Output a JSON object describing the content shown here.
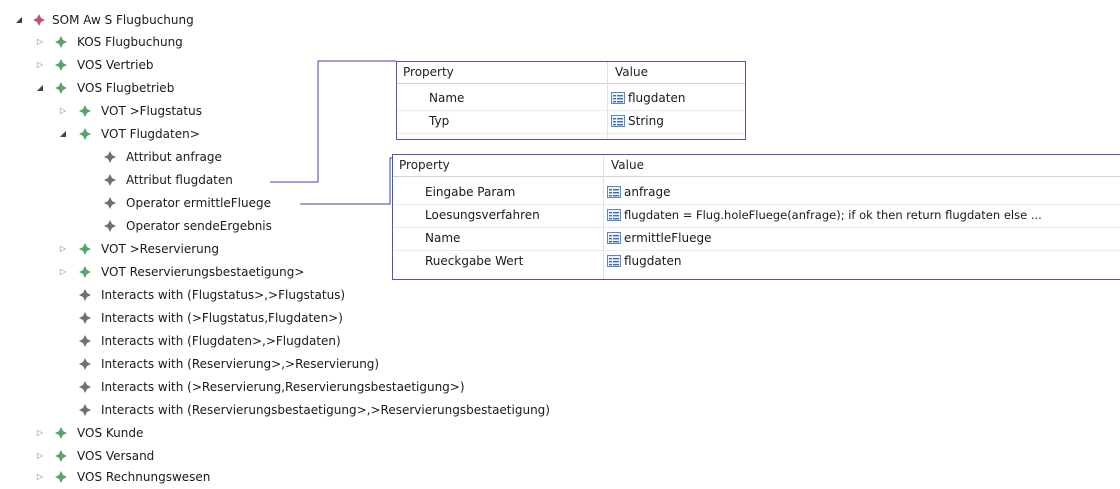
{
  "tree": {
    "root": "SOM Aw S Flugbuchung",
    "kos_flugbuchung": "KOS Flugbuchung",
    "vos_vertrieb": "VOS Vertrieb",
    "vos_flugbetrieb": "VOS Flugbetrieb",
    "vot_flugstatus": "VOT >Flugstatus",
    "vot_flugdaten": "VOT Flugdaten>",
    "attr_anfrage": "Attribut anfrage",
    "attr_flugdaten": "Attribut flugdaten",
    "op_ermittle": "Operator ermittleFluege",
    "op_sende": "Operator sendeErgebnis",
    "vot_reservierung": "VOT >Reservierung",
    "vot_resbest": "VOT Reservierungsbestaetigung>",
    "inter_1": "Interacts with (Flugstatus>,>Flugstatus)",
    "inter_2": "Interacts with (>Flugstatus,Flugdaten>)",
    "inter_3": "Interacts with (Flugdaten>,>Flugdaten)",
    "inter_4": "Interacts with (Reservierung>,>Reservierung)",
    "inter_5": "Interacts with (>Reservierung,Reservierungsbestaetigung>)",
    "inter_6": "Interacts with (Reservierungsbestaetigung>,>Reservierungsbestaetigung)",
    "vos_kunde": "VOS Kunde",
    "vos_versand": "VOS Versand",
    "vos_rechnung": "VOS Rechnungswesen"
  },
  "props_attr": {
    "header_property": "Property",
    "header_value": "Value",
    "rows": [
      {
        "name": "Name",
        "value": "flugdaten"
      },
      {
        "name": "Typ",
        "value": "String"
      }
    ]
  },
  "props_op": {
    "header_property": "Property",
    "header_value": "Value",
    "rows": [
      {
        "name": "Eingabe Param",
        "value": "anfrage"
      },
      {
        "name": "Loesungsverfahren",
        "value": "flugdaten = Flug.holeFluege(anfrage); if ok then return flugdaten else ..."
      },
      {
        "name": "Name",
        "value": "ermittleFluege"
      },
      {
        "name": "Rueckgabe Wert",
        "value": "flugdaten"
      }
    ]
  },
  "colors": {
    "root_icon": "#c0506a",
    "node_icon": "#5aa46a",
    "leaf_icon": "#707070",
    "connector": "#3a46b0"
  }
}
